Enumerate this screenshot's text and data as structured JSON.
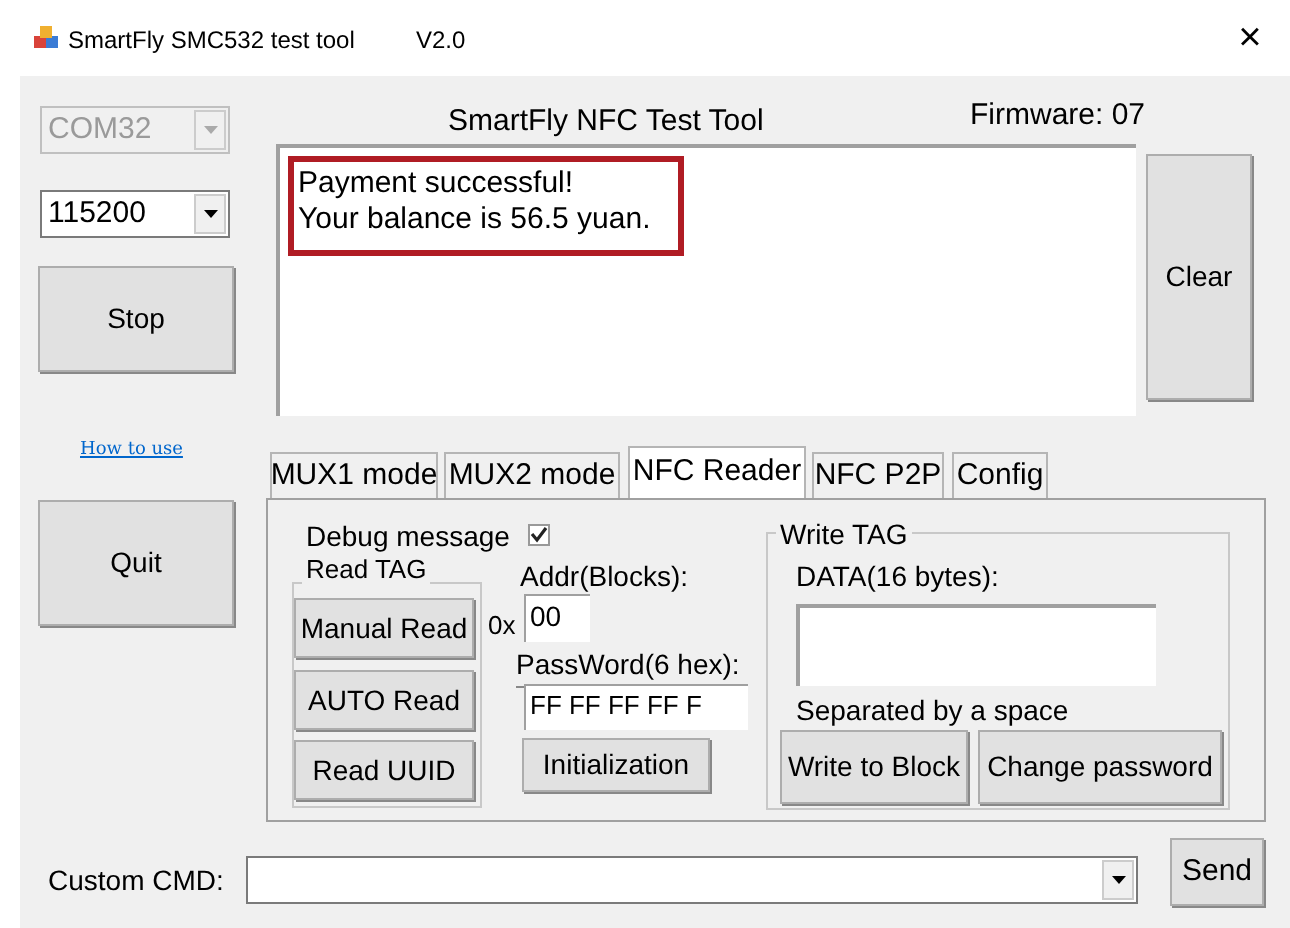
{
  "window": {
    "title": "SmartFly SMC532 test tool",
    "version": "V2.0",
    "close": "×"
  },
  "port": {
    "value": "COM32",
    "disabled": true
  },
  "baud": {
    "value": "115200",
    "disabled": false
  },
  "stop_button": "Stop",
  "how_to_use": "How to use",
  "quit_button": "Quit",
  "header": "SmartFly NFC Test Tool",
  "firmware": "Firmware: 07",
  "output": {
    "lines": [
      "Payment successful!",
      "Your balance is 56.5 yuan."
    ],
    "highlighted": true
  },
  "clear_button": "Clear",
  "tabs": [
    {
      "label": "MUX1 mode",
      "selected": false
    },
    {
      "label": "MUX2 mode",
      "selected": false
    },
    {
      "label": "NFC Reader",
      "selected": true
    },
    {
      "label": "NFC P2P",
      "selected": false
    },
    {
      "label": "Config",
      "selected": false
    }
  ],
  "debug": {
    "label": "Debug message",
    "checked": true
  },
  "read_tag": {
    "title": "Read TAG",
    "buttons": [
      "Manual Read",
      "AUTO Read",
      "Read UUID"
    ]
  },
  "addr": {
    "label": "Addr(Blocks):",
    "prefix": "0x",
    "value": "00"
  },
  "password": {
    "label": "PassWord(6 hex):",
    "value": "FF FF FF FF F"
  },
  "init_button": "Initialization",
  "write_tag": {
    "title": "Write TAG",
    "data_label": "DATA(16 bytes):",
    "hint": "Separated by a space",
    "buttons": [
      "Write to Block",
      "Change password"
    ]
  },
  "custom_cmd": {
    "label": "Custom CMD:"
  },
  "send_button": "Send"
}
